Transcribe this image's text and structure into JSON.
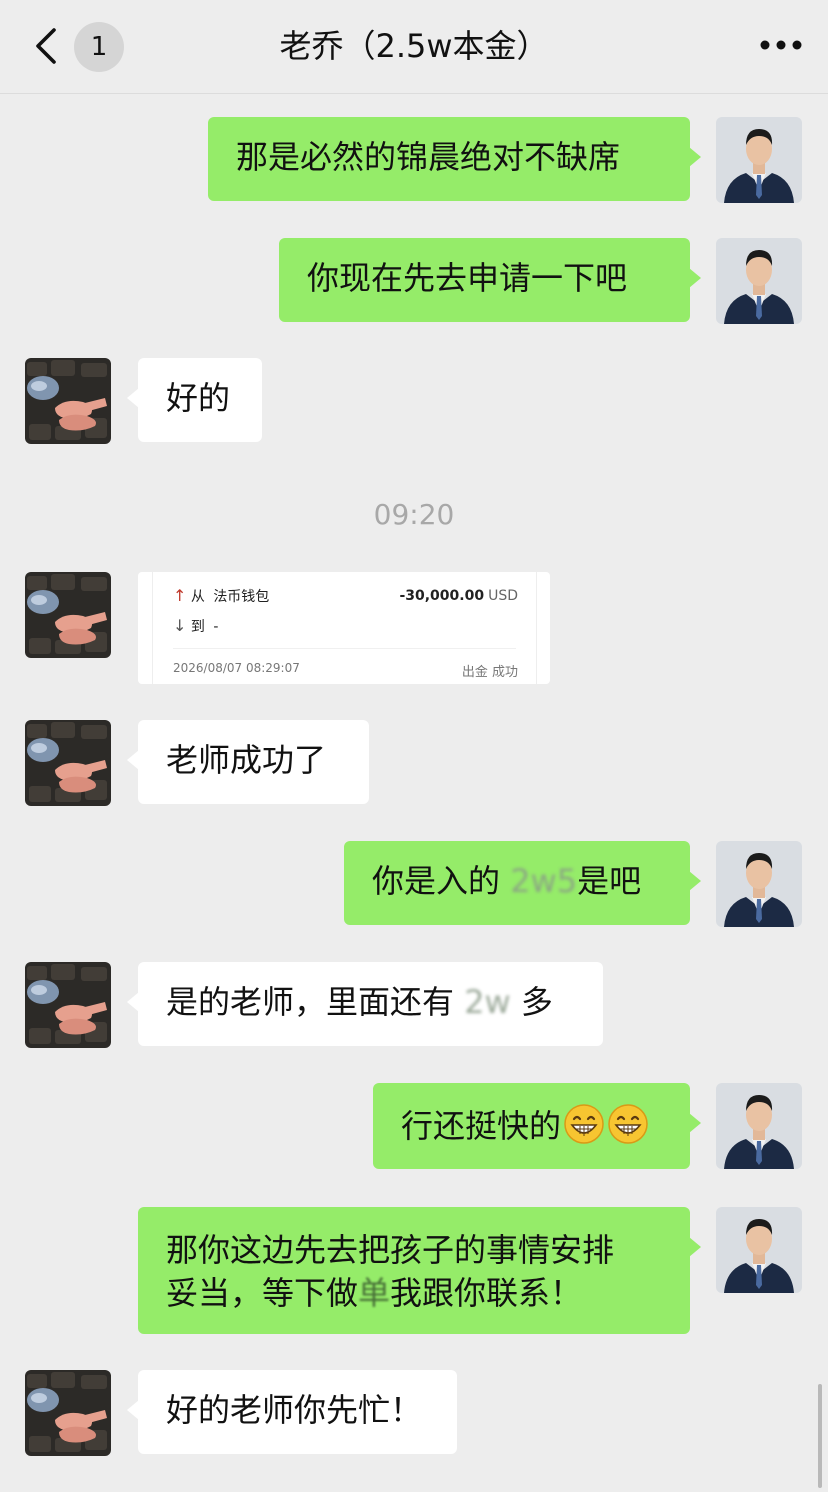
{
  "header": {
    "title": "老乔（2.5w本金）",
    "unread_count": "1",
    "back_icon": "chevron-left-icon",
    "more_icon": "more-dots-icon"
  },
  "messages": [
    {
      "side": "me",
      "text": "那是必然的锦晨绝对不缺席"
    },
    {
      "side": "me",
      "text": "你现在先去申请一下吧"
    },
    {
      "side": "peer",
      "text": "好的"
    },
    {
      "side": "peer",
      "type": "image-card"
    },
    {
      "side": "peer",
      "text": "老师成功了"
    },
    {
      "side": "me",
      "text_before": "你是入的",
      "text_obscured": "2w5",
      "text_after": "是吧"
    },
    {
      "side": "peer",
      "text_before": "是的老师，里面还有",
      "text_obscured": "2w",
      "text_after": "多"
    },
    {
      "side": "me",
      "text": "行还挺快的",
      "emoji": [
        "grinning-face-emoji",
        "grinning-face-emoji"
      ]
    },
    {
      "side": "me",
      "line1": "那你这边先去把孩子的事情安排",
      "line2_before": "妥当，等下做",
      "line2_obscured": "单",
      "line2_after": "我跟你联系！"
    },
    {
      "side": "peer",
      "text": "好的老师你先忙！"
    }
  ],
  "timestamp": "09:20",
  "transfer_card": {
    "from_label": "从",
    "from_value": "法币钱包",
    "to_label": "到",
    "to_value": "-",
    "amount": "-30,000.00",
    "currency": "USD",
    "datetime": "2026/08/07 08:29:07",
    "status": "出金 成功"
  },
  "colors": {
    "background": "#ededed",
    "my_bubble": "#95ec69",
    "peer_bubble": "#ffffff",
    "timestamp": "#a8a8a8"
  }
}
